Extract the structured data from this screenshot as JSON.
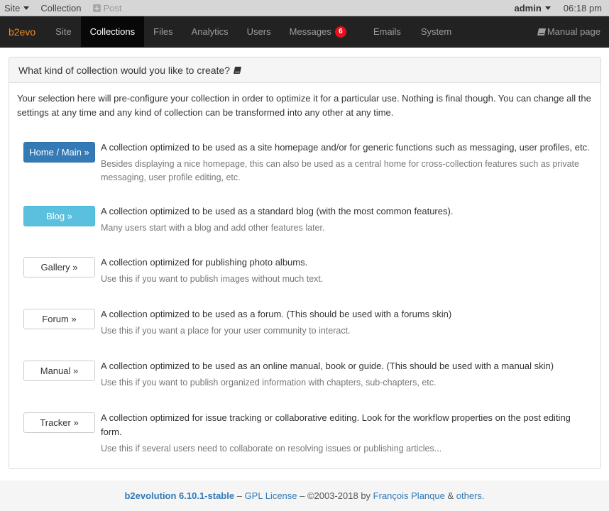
{
  "evobar": {
    "site_label": "Site",
    "collection_label": "Collection",
    "post_label": "Post",
    "user_label": "admin",
    "time": "06:18 pm"
  },
  "navbar": {
    "brand": "b2evo",
    "items": [
      {
        "label": "Site",
        "active": false
      },
      {
        "label": "Collections",
        "active": true
      },
      {
        "label": "Files",
        "active": false
      },
      {
        "label": "Analytics",
        "active": false
      },
      {
        "label": "Users",
        "active": false
      },
      {
        "label": "Messages",
        "active": false,
        "badge": "6"
      },
      {
        "label": "Emails",
        "active": false
      },
      {
        "label": "System",
        "active": false
      }
    ],
    "manual_label": "Manual page"
  },
  "panel": {
    "title": "What kind of collection would you like to create?",
    "intro": "Your selection here will pre-configure your collection in order to optimize it for a particular use. Nothing is final though. You can change all the settings at any time and any kind of collection can be transformed into any other at any time.",
    "options": [
      {
        "button": "Home / Main »",
        "style": "primary",
        "title": "A collection optimized to be used as a site homepage and/or for generic functions such as messaging, user profiles, etc.",
        "note": "Besides displaying a nice homepage, this can also be used as a central home for cross-collection features such as private messaging, user profile editing, etc."
      },
      {
        "button": "Blog »",
        "style": "info",
        "title": "A collection optimized to be used as a standard blog (with the most common features).",
        "note": "Many users start with a blog and add other features later."
      },
      {
        "button": "Gallery »",
        "style": "default",
        "title": "A collection optimized for publishing photo albums.",
        "note": "Use this if you want to publish images without much text."
      },
      {
        "button": "Forum »",
        "style": "default",
        "title": "A collection optimized to be used as a forum. (This should be used with a forums skin)",
        "note": "Use this if you want a place for your user community to interact."
      },
      {
        "button": "Manual »",
        "style": "default",
        "title": "A collection optimized to be used as an online manual, book or guide. (This should be used with a manual skin)",
        "note": "Use this if you want to publish organized information with chapters, sub-chapters, etc."
      },
      {
        "button": "Tracker »",
        "style": "default",
        "title": "A collection optimized for issue tracking or collaborative editing. Look for the workflow properties on the post editing form.",
        "note": "Use this if several users need to collaborate on resolving issues or publishing articles..."
      }
    ]
  },
  "footer": {
    "product": "b2evolution 6.10.1-stable",
    "sep1": " – ",
    "license": "GPL License",
    "copyright": " – ©2003-2018 by ",
    "author": "François Planque",
    "amp": " & ",
    "others": "others.",
    "link_color": "#337ab7"
  },
  "colors": {
    "brand": "#f58a1f",
    "primary": "#337ab7",
    "info": "#5bc0de",
    "badge": "#e5121b",
    "navbar": "#222222"
  }
}
